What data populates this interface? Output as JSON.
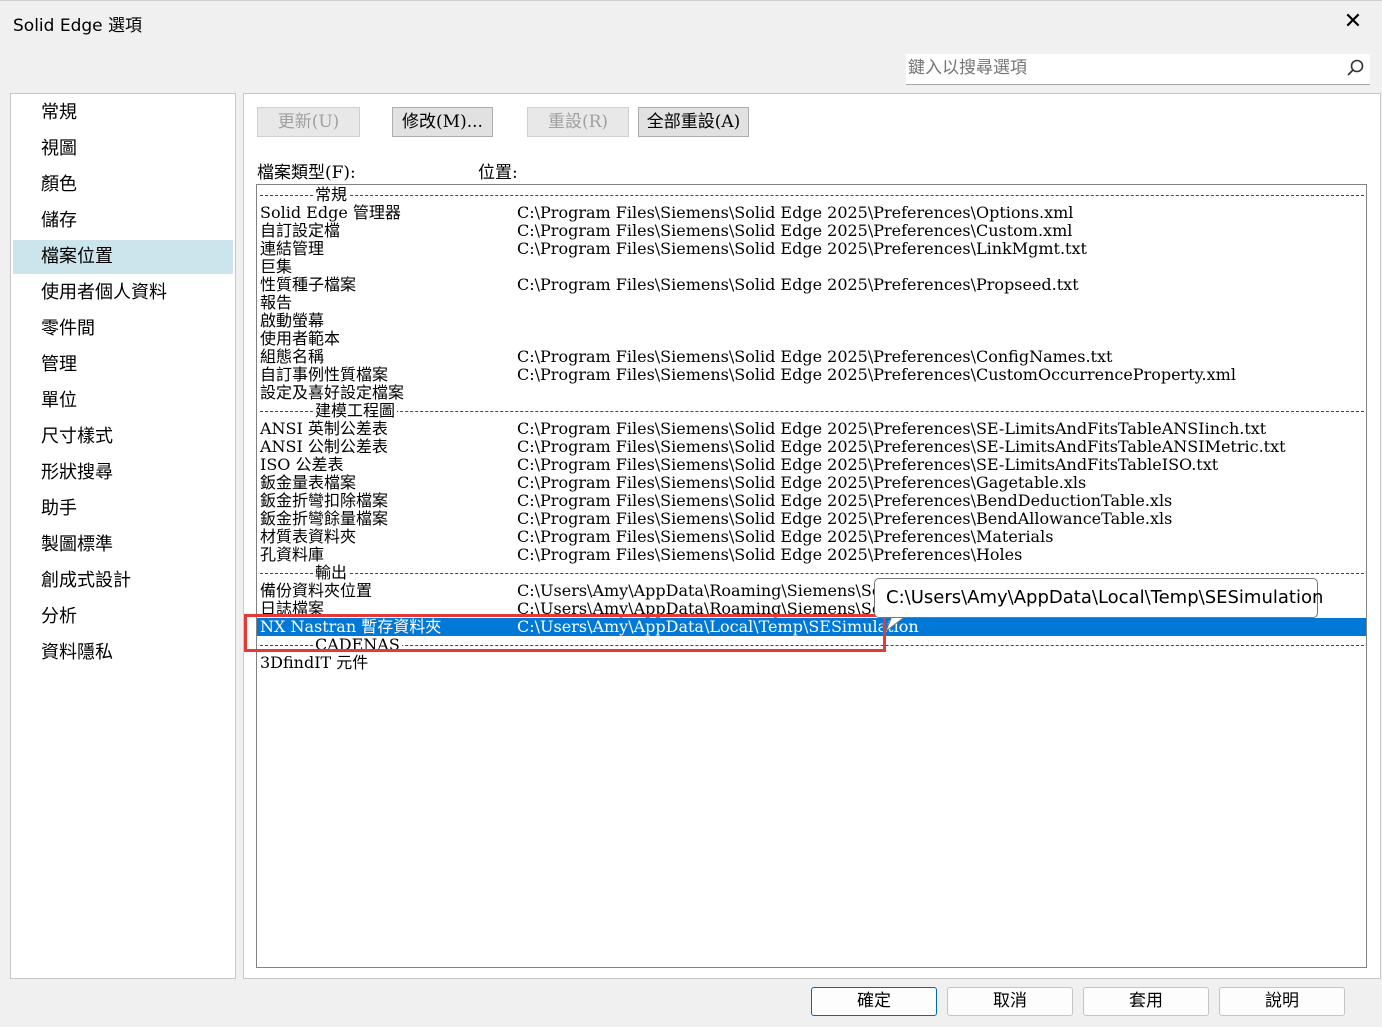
{
  "window": {
    "title": "Solid Edge 選項",
    "close_glyph": "✕"
  },
  "search": {
    "placeholder": "鍵入以搜尋選項",
    "icon": "search-icon"
  },
  "sidebar": {
    "items": [
      "常規",
      "視圖",
      "顏色",
      "儲存",
      "檔案位置",
      "使用者個人資料",
      "零件間",
      "管理",
      "單位",
      "尺寸樣式",
      "形狀搜尋",
      "助手",
      "製圖標準",
      "創成式設計",
      "分析",
      "資料隱私"
    ],
    "selected": "檔案位置"
  },
  "toolbar": {
    "update_label": "更新(U)",
    "modify_label": "修改(M)...",
    "reset_label": "重設(R)",
    "reset_all_label": "全部重設(A)"
  },
  "list": {
    "file_type_label": "檔案類型(F):",
    "location_label": "位置:",
    "rows": [
      {
        "type": "header",
        "name": "常規"
      },
      {
        "name": "Solid Edge 管理器",
        "path": "C:\\Program Files\\Siemens\\Solid Edge 2025\\Preferences\\Options.xml"
      },
      {
        "name": "自訂設定檔",
        "path": "C:\\Program Files\\Siemens\\Solid Edge 2025\\Preferences\\Custom.xml"
      },
      {
        "name": "連結管理",
        "path": "C:\\Program Files\\Siemens\\Solid Edge 2025\\Preferences\\LinkMgmt.txt"
      },
      {
        "name": "巨集",
        "path": ""
      },
      {
        "name": "性質種子檔案",
        "path": "C:\\Program Files\\Siemens\\Solid Edge 2025\\Preferences\\Propseed.txt"
      },
      {
        "name": "報告",
        "path": ""
      },
      {
        "name": "啟動螢幕",
        "path": ""
      },
      {
        "name": "使用者範本",
        "path": ""
      },
      {
        "name": "組態名稱",
        "path": "C:\\Program Files\\Siemens\\Solid Edge 2025\\Preferences\\ConfigNames.txt"
      },
      {
        "name": "自訂事例性質檔案",
        "path": "C:\\Program Files\\Siemens\\Solid Edge 2025\\Preferences\\CustomOccurrenceProperty.xml"
      },
      {
        "name": "設定及喜好設定檔案",
        "path": ""
      },
      {
        "type": "header",
        "name": "建模工程圖"
      },
      {
        "name": "ANSI 英制公差表",
        "path": "C:\\Program Files\\Siemens\\Solid Edge 2025\\Preferences\\SE-LimitsAndFitsTableANSIinch.txt"
      },
      {
        "name": "ANSI 公制公差表",
        "path": "C:\\Program Files\\Siemens\\Solid Edge 2025\\Preferences\\SE-LimitsAndFitsTableANSIMetric.txt"
      },
      {
        "name": "ISO 公差表",
        "path": "C:\\Program Files\\Siemens\\Solid Edge 2025\\Preferences\\SE-LimitsAndFitsTableISO.txt"
      },
      {
        "name": "鈑金量表檔案",
        "path": "C:\\Program Files\\Siemens\\Solid Edge 2025\\Preferences\\Gagetable.xls"
      },
      {
        "name": "鈑金折彎扣除檔案",
        "path": "C:\\Program Files\\Siemens\\Solid Edge 2025\\Preferences\\BendDeductionTable.xls"
      },
      {
        "name": "鈑金折彎餘量檔案",
        "path": "C:\\Program Files\\Siemens\\Solid Edge 2025\\Preferences\\BendAllowanceTable.xls"
      },
      {
        "name": "材質表資料夾",
        "path": "C:\\Program Files\\Siemens\\Solid Edge 2025\\Preferences\\Materials"
      },
      {
        "name": "孔資料庫",
        "path": "C:\\Program Files\\Siemens\\Solid Edge 2025\\Preferences\\Holes"
      },
      {
        "type": "header",
        "name": "輸出"
      },
      {
        "name": "備份資料夾位置",
        "path": "C:\\Users\\Amy\\AppData\\Roaming\\Siemens\\Solid Ed"
      },
      {
        "name": "日誌檔案",
        "path": "C:\\Users\\Amy\\AppData\\Roaming\\Siemens\\Solid Ed"
      },
      {
        "name": "NX Nastran 暫存資料夾",
        "path": "C:\\Users\\Amy\\AppData\\Local\\Temp\\SESimulation",
        "selected": true
      },
      {
        "type": "header",
        "name": "CADENAS"
      },
      {
        "name": "3DfindIT 元件",
        "path": ""
      }
    ]
  },
  "tooltip": {
    "text": "C:\\Users\\Amy\\AppData\\Local\\Temp\\SESimulation"
  },
  "footer": {
    "ok_label": "確定",
    "cancel_label": "取消",
    "apply_label": "套用",
    "help_label": "說明"
  },
  "colors": {
    "selection": "#0078d7",
    "sidebar_selection": "#cce4ec",
    "highlight_box": "#e53935"
  }
}
